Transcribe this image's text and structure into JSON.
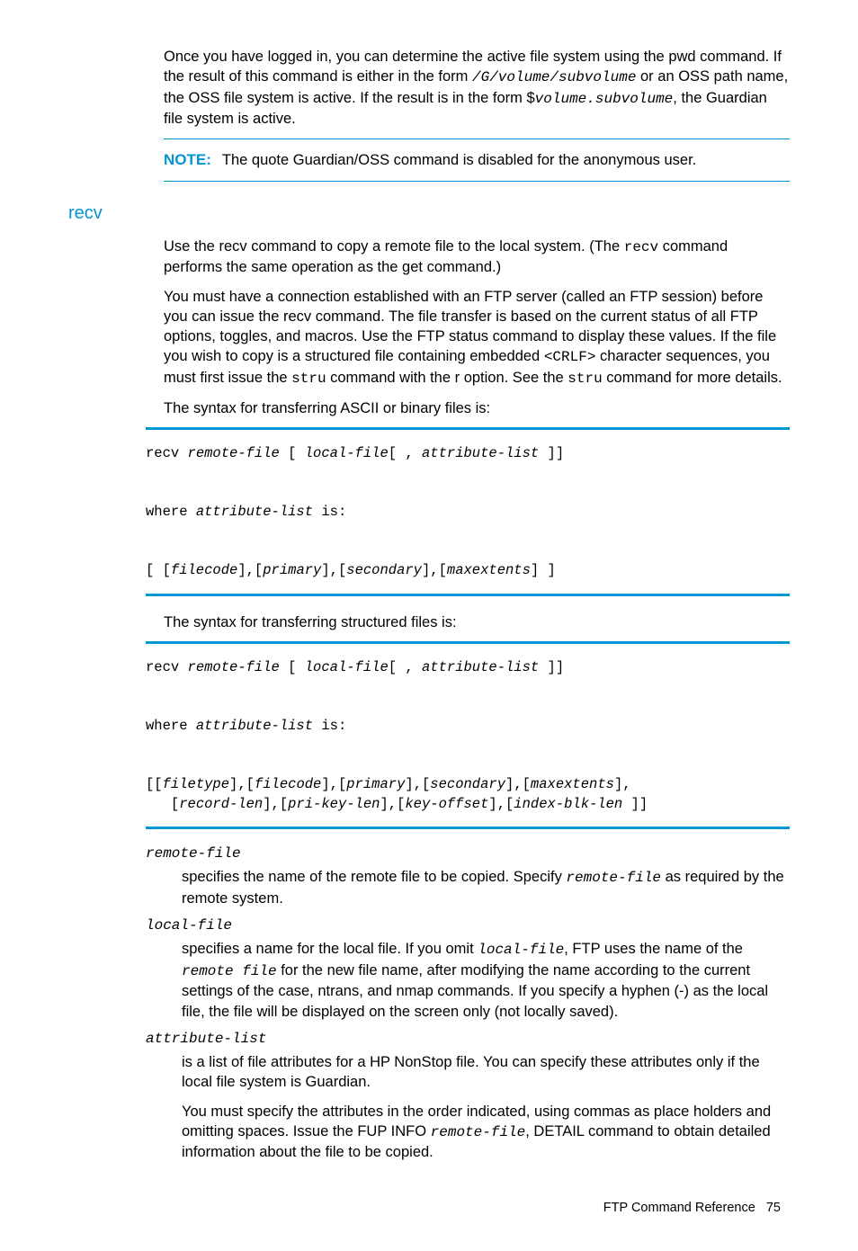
{
  "intro": {
    "p1_a": "Once you have logged in, you can determine the active file system using the pwd command. If the result of this command is either in the form ",
    "p1_code1": "/G/volume/subvolume",
    "p1_b": " or an OSS path name, the OSS file system is active. If the result is in the form $",
    "p1_code2": "volume.subvolume",
    "p1_c": ", the Guardian file system is active."
  },
  "note": {
    "label": "NOTE:",
    "text": "The quote Guardian/OSS command is disabled for the anonymous user."
  },
  "section_title": "recv",
  "recv": {
    "p1_a": "Use the recv command to copy a remote file to the local system. (The ",
    "p1_code": "recv",
    "p1_b": " command performs the same operation as the get command.)",
    "p2_a": "You must have a connection established with an FTP server (called an FTP session) before you can issue the recv command. The file transfer is based on the current status of all FTP options, toggles, and macros. Use the FTP status command to display these values. If the file you wish to copy is a structured file containing embedded ",
    "p2_code1": "<CRLF>",
    "p2_b": " character sequences, you must first issue the ",
    "p2_code2": "stru",
    "p2_c": " command with the r option. See the ",
    "p2_code3": "stru",
    "p2_d": " command for more details.",
    "p3": "The syntax for transferring ASCII or binary files is:",
    "p4": "The syntax for transferring structured files is:"
  },
  "syntax1": {
    "l1a": "recv ",
    "l1b": "remote-file",
    "l1c": " [ ",
    "l1d": "local-file",
    "l1e": "[ , ",
    "l1f": "attribute-list",
    "l1g": " ]]",
    "l2a": "where ",
    "l2b": "attribute-list",
    "l2c": " is:",
    "l3a": "[ [",
    "l3b": "filecode",
    "l3c": "],[",
    "l3d": "primary",
    "l3e": "],[",
    "l3f": "secondary",
    "l3g": "],[",
    "l3h": "maxextents",
    "l3i": "] ]"
  },
  "syntax2": {
    "l1a": "recv ",
    "l1b": "remote-file",
    "l1c": " [ ",
    "l1d": "local-file",
    "l1e": "[ , ",
    "l1f": "attribute-list",
    "l1g": " ]]",
    "l2a": "where ",
    "l2b": "attribute-list",
    "l2c": " is:",
    "l3a": "[[",
    "l3b": "filetype",
    "l3c": "],[",
    "l3d": "filecode",
    "l3e": "],[",
    "l3f": "primary",
    "l3g": "],[",
    "l3h": "secondary",
    "l3i": "],[",
    "l3j": "maxextents",
    "l3k": "],",
    "l4a": "   [",
    "l4b": "record-len",
    "l4c": "],[",
    "l4d": "pri-key-len",
    "l4e": "],[",
    "l4f": "key-offset",
    "l4g": "],[",
    "l4h": "index-blk-len",
    "l4i": " ]]"
  },
  "params": {
    "remote_file": {
      "name": "remote-file",
      "d1a": "specifies the name of the remote file to be copied. Specify ",
      "d1code": "remote-file",
      "d1b": " as required by the remote system."
    },
    "local_file": {
      "name": "local-file",
      "d1a": "specifies a name for the local file. If you omit ",
      "d1code1": "local-file",
      "d1b": ", FTP uses the name of the ",
      "d1code2": "remote file",
      "d1c": " for the new file name, after modifying the name according to the current settings of the case, ntrans, and nmap commands. If you specify a hyphen (-) as the local file, the file will be displayed on the screen only (not locally saved)."
    },
    "attr_list": {
      "name": "attribute-list",
      "d1": "is a list of file attributes for a HP NonStop file. You can specify these attributes only if the local file system is Guardian.",
      "d2a": "You must specify the attributes in the order indicated, using commas as place holders and omitting spaces. Issue the FUP INFO ",
      "d2code": "remote-file",
      "d2b": ", DETAIL command to obtain detailed information about the file to be copied."
    }
  },
  "footer": {
    "text": "FTP Command Reference",
    "page": "75"
  }
}
